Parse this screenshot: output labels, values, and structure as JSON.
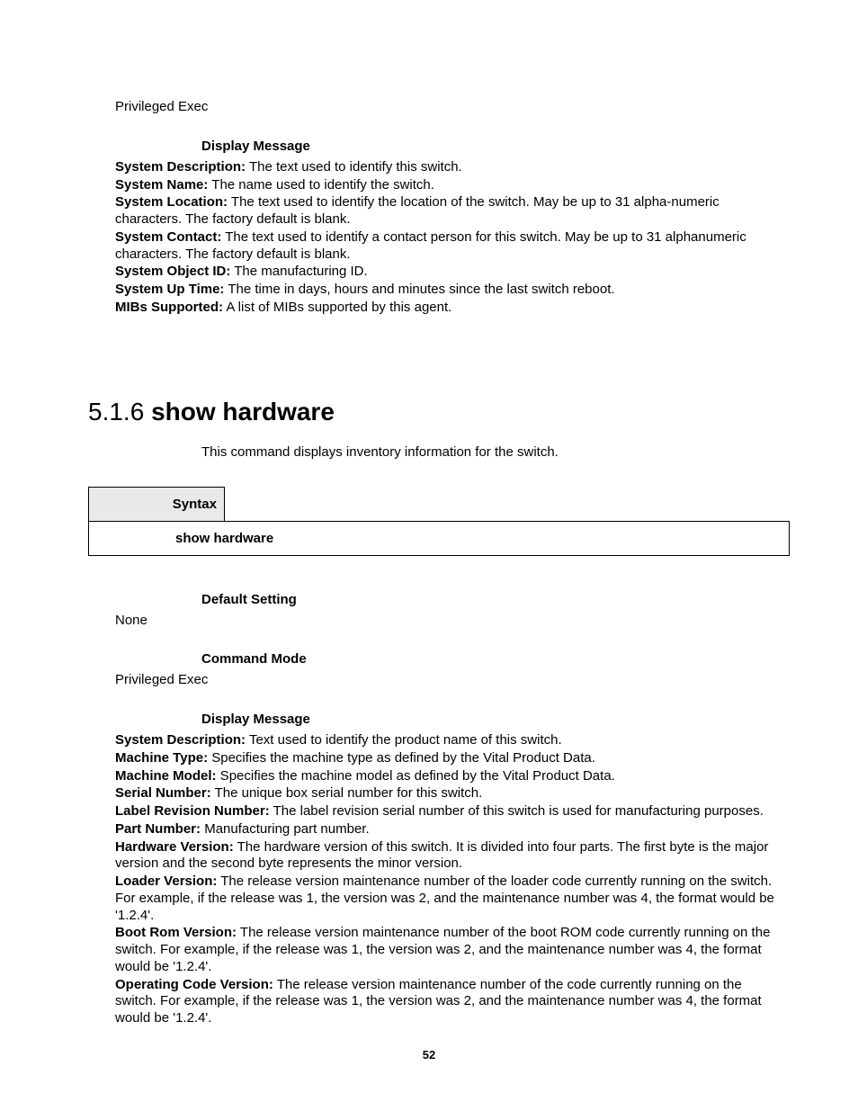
{
  "top": {
    "priv_exec": "Privileged Exec",
    "display_message": "Display Message",
    "fields": [
      {
        "label": "System Description:",
        "desc": " The text used to identify this switch."
      },
      {
        "label": "System Name:",
        "desc": " The name used to identify the switch."
      },
      {
        "label": "System Location:",
        "desc": " The text used to identify the location of the switch. May be up to 31 alpha-numeric characters. The factory default is blank."
      },
      {
        "label": "System Contact:",
        "desc": " The text used to identify a contact person for this switch. May be up to 31 alphanumeric characters. The factory default is blank."
      },
      {
        "label": "System Object ID:",
        "desc": " The manufacturing ID."
      },
      {
        "label": "System Up Time:",
        "desc": " The time in days, hours and minutes since the last switch reboot."
      },
      {
        "label": "MIBs Supported:",
        "desc": " A list of MIBs supported by this agent."
      }
    ]
  },
  "section": {
    "number": "5.1.6 ",
    "title": "show hardware",
    "intro": "This command displays inventory information for the switch.",
    "syntax_label": "Syntax",
    "syntax_cmd": "show hardware",
    "default_setting_label": "Default Setting",
    "default_setting_value": "None",
    "command_mode_label": "Command Mode",
    "command_mode_value": "Privileged Exec",
    "display_message_label": "Display Message",
    "fields": [
      {
        "label": "System Description:",
        "desc": " Text used to identify the product name of this switch."
      },
      {
        "label": "Machine Type:",
        "desc": " Specifies the machine type as defined by the Vital Product Data."
      },
      {
        "label": "Machine Model:",
        "desc": " Specifies the machine model as defined by the Vital Product Data."
      },
      {
        "label": "Serial Number:",
        "desc": " The unique box serial number for this switch."
      },
      {
        "label": "Label Revision Number:",
        "desc": " The label revision serial number of this switch is used for manufacturing purposes."
      },
      {
        "label": "Part Number:",
        "desc": " Manufacturing part number."
      },
      {
        "label": "Hardware Version:",
        "desc": " The hardware version of this switch. It is divided into four parts. The first byte is the major version and the second byte represents the minor version."
      },
      {
        "label": "Loader Version:",
        "desc": " The release version maintenance number of the loader code currently running on the switch. For example, if the release was 1, the version was 2, and the maintenance number was 4, the format would be '1.2.4'."
      },
      {
        "label": "Boot Rom Version:",
        "desc": " The release version maintenance number of the boot ROM code currently running on the switch. For example, if the release was 1, the version was 2, and the maintenance number was 4, the format would be '1.2.4'."
      },
      {
        "label": "Operating Code Version:",
        "desc": " The release version maintenance number of the code currently running on the switch. For example, if the release was 1, the version was 2, and the maintenance number was 4, the format would be '1.2.4'."
      }
    ]
  },
  "page_number": "52"
}
